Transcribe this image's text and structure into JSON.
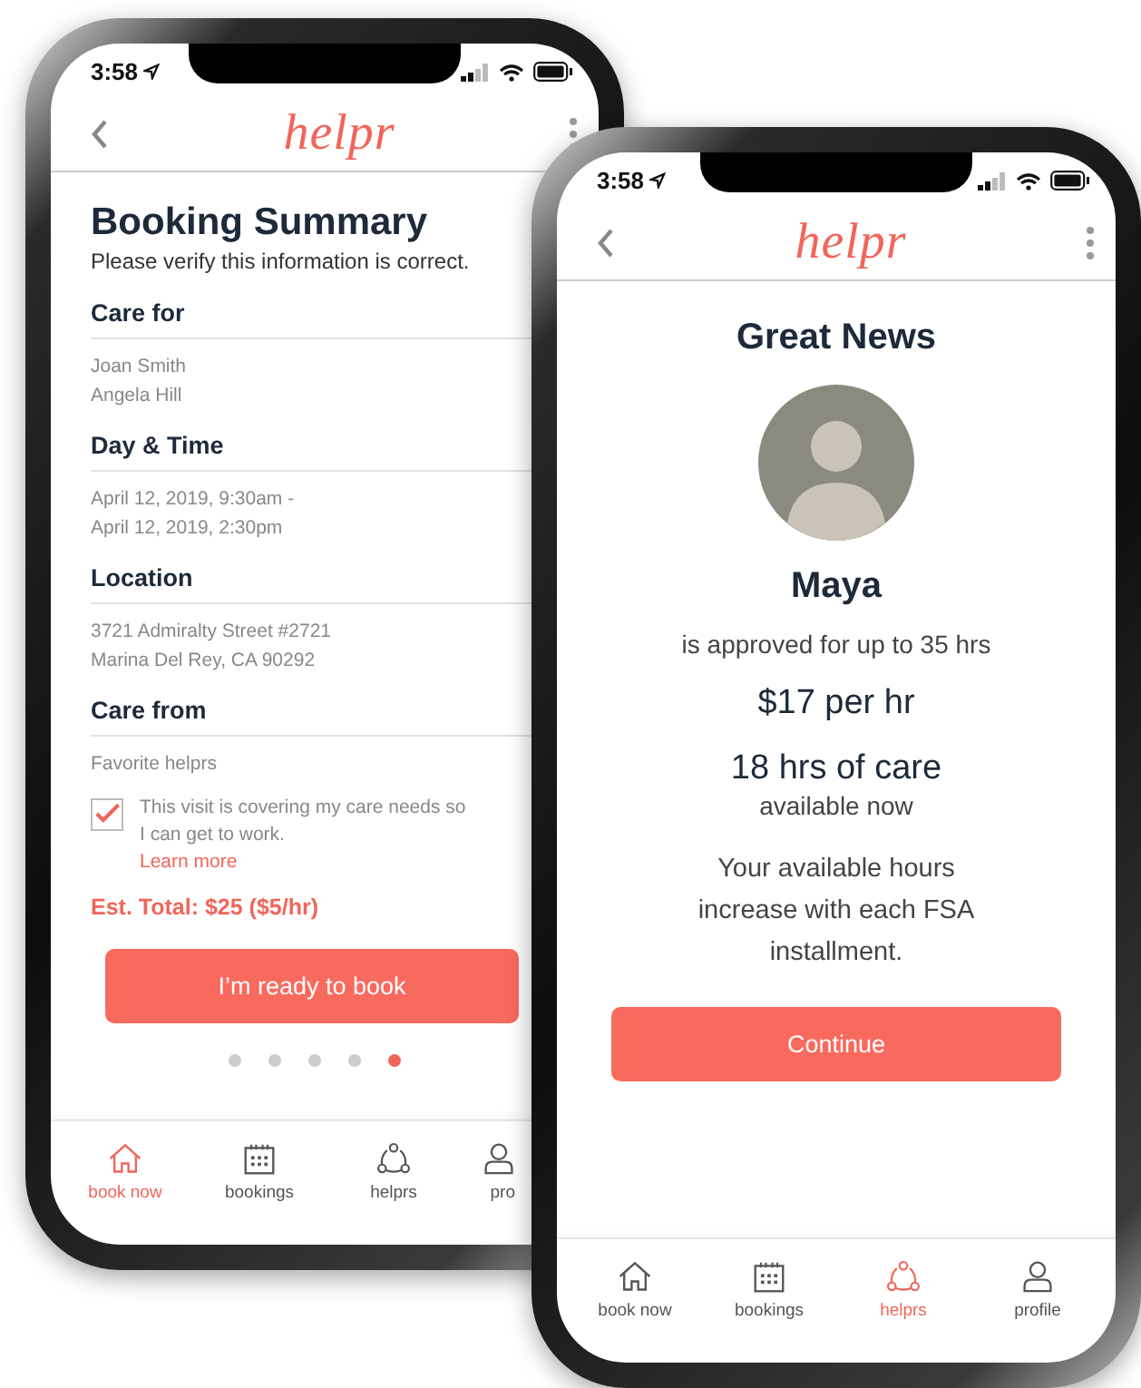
{
  "booking_screen": {
    "status_time": "3:58",
    "logo": "helpr",
    "title": "Booking Summary",
    "subtitle": "Please verify this information is correct.",
    "sections": [
      {
        "heading": "Care for",
        "lines": [
          "Joan Smith",
          "Angela Hill"
        ]
      },
      {
        "heading": "Day & Time",
        "lines": [
          "April 12, 2019, 9:30am -",
          "April 12, 2019, 2:30pm"
        ]
      },
      {
        "heading": "Location",
        "lines": [
          "3721 Admiralty Street #2721",
          "Marina Del Rey, CA 90292"
        ]
      },
      {
        "heading": "Care from",
        "lines": [
          "Favorite helprs"
        ]
      }
    ],
    "checkbox": {
      "checked": true,
      "text": "This visit is covering my care needs so I can get to work.",
      "link": "Learn more"
    },
    "total": "Est. Total: $25 ($5/hr)",
    "button": "I’m ready to book",
    "page_dots": [
      {
        "selected": false
      },
      {
        "selected": false
      },
      {
        "selected": false
      },
      {
        "selected": false
      },
      {
        "selected": true
      }
    ],
    "nav": [
      {
        "kind": "home",
        "label": "book now",
        "selected": true
      },
      {
        "kind": "calendar",
        "label": "bookings",
        "selected": false
      },
      {
        "kind": "people",
        "label": "helprs",
        "selected": false
      },
      {
        "kind": "person",
        "label": "pro",
        "selected": false
      }
    ]
  },
  "approval_screen": {
    "status_time": "3:58",
    "logo": "helpr",
    "title": "Great News",
    "name": "Maya",
    "approval": "is approved for up to 35 hrs",
    "rate": "$17 per hr",
    "hours": "18 hrs of care",
    "hours_note": "available now",
    "info": "Your available hours increase with each FSA installment.",
    "button": "Continue",
    "nav": [
      {
        "kind": "home",
        "label": "book now",
        "selected": false
      },
      {
        "kind": "calendar",
        "label": "bookings",
        "selected": false
      },
      {
        "kind": "people",
        "label": "helprs",
        "selected": true
      },
      {
        "kind": "person",
        "label": "profile",
        "selected": false
      }
    ]
  }
}
